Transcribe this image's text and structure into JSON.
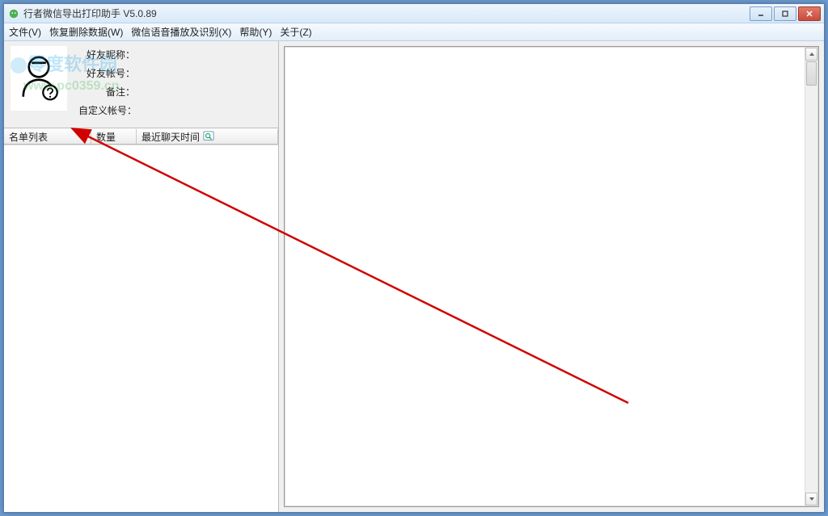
{
  "window": {
    "title": "行者微信导出打印助手   V5.0.89"
  },
  "menu": {
    "file": "文件(V)",
    "recover": "恢复删除数据(W)",
    "voice": "微信语音播放及识别(X)",
    "help": "帮助(Y)",
    "about": "关于(Z)"
  },
  "info": {
    "nickname_label": "好友昵称：",
    "account_label": "好友帐号：",
    "remark_label": "备注：",
    "custom_label": "自定义帐号：",
    "nickname_value": "",
    "account_value": "",
    "remark_value": "",
    "custom_value": ""
  },
  "columns": {
    "c1": "名单列表",
    "c2": "数量",
    "c3": "最近聊天时间"
  },
  "watermark": {
    "line1": "零度软件园",
    "line2": "www.pc0359.cn"
  },
  "icons": {
    "app": "app-icon",
    "minimize": "minimize-icon",
    "maximize": "maximize-icon",
    "close": "close-icon",
    "avatar": "person-unknown-icon",
    "search": "magnifier-icon",
    "scroll_up": "chevron-up-icon",
    "scroll_down": "chevron-down-icon"
  }
}
